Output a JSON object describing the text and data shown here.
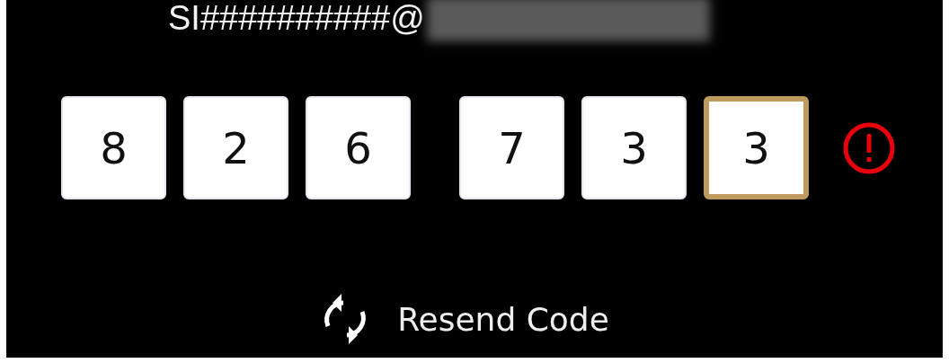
{
  "account": {
    "email_prefix": "SI##########@"
  },
  "code": {
    "digits": [
      {
        "value": "8",
        "focused": false
      },
      {
        "value": "2",
        "focused": false
      },
      {
        "value": "6",
        "focused": false
      },
      {
        "value": "7",
        "focused": false
      },
      {
        "value": "3",
        "focused": false
      },
      {
        "value": "3",
        "focused": true
      }
    ],
    "error": true
  },
  "resend": {
    "label": "Resend Code"
  }
}
